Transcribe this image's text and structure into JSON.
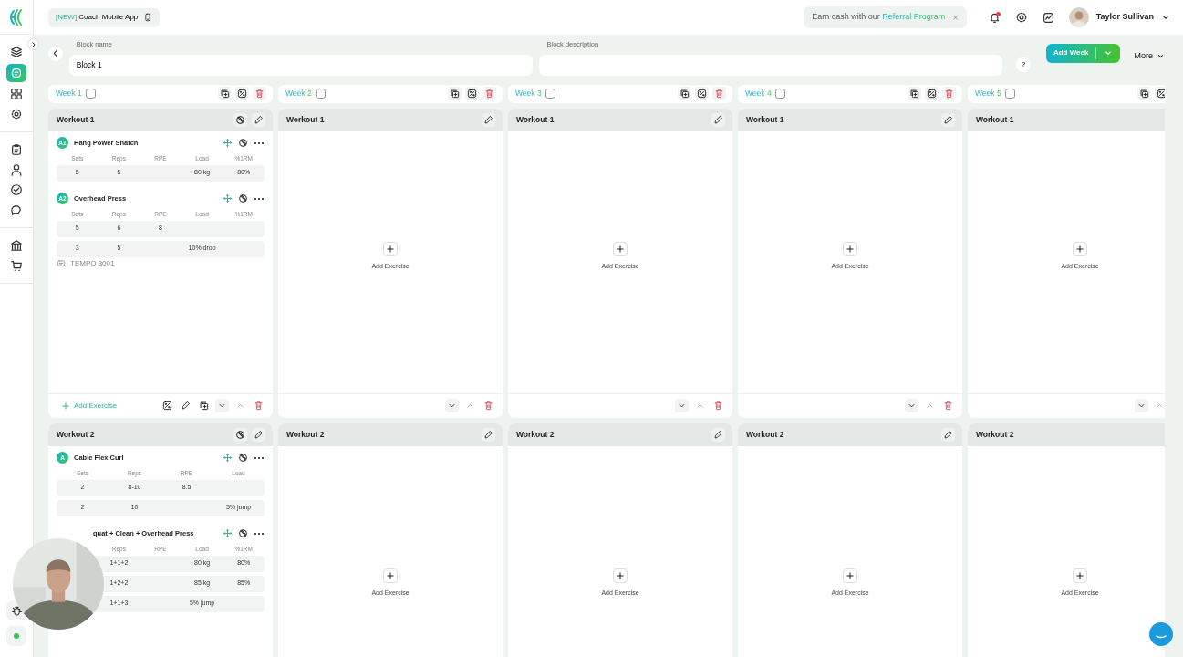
{
  "app_chip": {
    "tag": "[NEW]",
    "label": "Coach Mobile App"
  },
  "referral": {
    "text": "Earn cash with our ",
    "link": "Referral Program",
    "close": "×"
  },
  "user": {
    "name": "Taylor Sullivan"
  },
  "sidebar": {
    "groups": [
      [
        {
          "kind": "layers",
          "selected": false
        },
        {
          "kind": "programs",
          "selected": true
        },
        {
          "kind": "grid",
          "selected": false
        },
        {
          "kind": "settings",
          "selected": false
        }
      ],
      [
        {
          "kind": "clipboard",
          "selected": false
        },
        {
          "kind": "person",
          "selected": false
        },
        {
          "kind": "check",
          "selected": false
        },
        {
          "kind": "chat",
          "selected": false
        }
      ],
      [
        {
          "kind": "bank",
          "selected": false
        },
        {
          "kind": "cart",
          "selected": false
        }
      ]
    ],
    "bottom": [
      {
        "kind": "bug",
        "selected": false
      },
      {
        "kind": "dot",
        "selected": false
      }
    ]
  },
  "block": {
    "name_label": "Block name",
    "name_value": "Block 1",
    "description_label": "Block description",
    "help": "?"
  },
  "actions": {
    "add_week": "Add Week",
    "more": "More"
  },
  "weeks": [
    {
      "label": "Week 1",
      "checked": false
    },
    {
      "label": "Week 2",
      "checked": false
    },
    {
      "label": "Week 3",
      "checked": false
    },
    {
      "label": "Week 4",
      "checked": false
    },
    {
      "label": "Week 5",
      "checked": false
    }
  ],
  "workout_rows": [
    {
      "footer_shown": true,
      "cells": [
        {
          "title": "Workout 1",
          "add_label": "Add Exercise",
          "exercises": [
            {
              "marker": "A1",
              "name": "Hang Power Snatch",
              "columns": [
                "Sets",
                "Reps",
                "RPE",
                "Load",
                "%1RM"
              ],
              "rows": [
                [
                  "5",
                  "5",
                  null,
                  "80 kg",
                  "80%"
                ]
              ]
            },
            {
              "marker": "A2",
              "name": "Overhead Press",
              "columns": [
                "Sets",
                "Reps",
                "RPE",
                "Load",
                "%1RM"
              ],
              "rows": [
                [
                  "5",
                  "6",
                  "8",
                  null,
                  null
                ],
                [
                  "3",
                  "5",
                  null,
                  "10% drop",
                  null
                ]
              ],
              "note": "TEMPO 3001"
            }
          ]
        },
        {
          "title": "Workout 1",
          "add_label": "Add Exercise"
        },
        {
          "title": "Workout 1",
          "add_label": "Add Exercise"
        },
        {
          "title": "Workout 1",
          "add_label": "Add Exercise"
        },
        {
          "title": "Workout 1",
          "add_label": "Add Exercise"
        }
      ]
    },
    {
      "footer_shown": false,
      "cells": [
        {
          "title": "Workout 2",
          "exercises": [
            {
              "marker": "A",
              "name": "Cable Flex Curl",
              "columns": [
                "Sets",
                "Reps",
                "RPE",
                "Load"
              ],
              "rows": [
                [
                  "2",
                  "8-10",
                  "8.5",
                  null
                ],
                [
                  "2",
                  "10",
                  null,
                  "5% jump"
                ]
              ]
            },
            {
              "name": "quat + Clean + Overhead Press",
              "columns": [
                null,
                "Reps",
                "RPE",
                "Load",
                "%1RM"
              ],
              "rows": [
                [
                  null,
                  "1+1+2",
                  null,
                  "80 kg",
                  "80%"
                ],
                [
                  null,
                  "1+2+2",
                  null,
                  "85 kg",
                  "85%"
                ],
                [
                  null,
                  "1+1+3",
                  null,
                  "5% jump",
                  null
                ]
              ]
            }
          ]
        },
        {
          "title": "Workout 2",
          "add_label": "Add Exercise"
        },
        {
          "title": "Workout 2",
          "add_label": "Add Exercise"
        },
        {
          "title": "Workout 2",
          "add_label": "Add Exercise"
        },
        {
          "title": "Workout 2",
          "add_label": "Add Exercise"
        }
      ]
    }
  ]
}
